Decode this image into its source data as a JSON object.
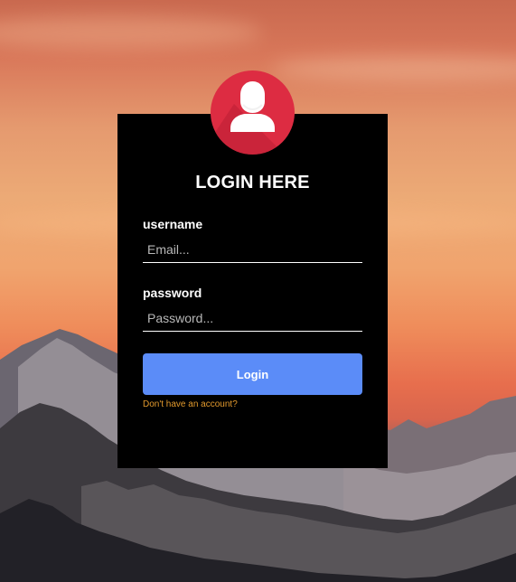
{
  "form": {
    "title": "LOGIN HERE",
    "username_label": "username",
    "username_placeholder": "Email...",
    "password_label": "password",
    "password_placeholder": "Password...",
    "login_label": "Login",
    "signup_link": "Don't have an account?"
  },
  "colors": {
    "card_background": "#000000",
    "avatar_background": "#dd2c42",
    "button_background": "#5b8cf8",
    "link_color": "#e39a2d",
    "text_color": "#ffffff"
  },
  "icons": {
    "avatar": "user-icon"
  }
}
